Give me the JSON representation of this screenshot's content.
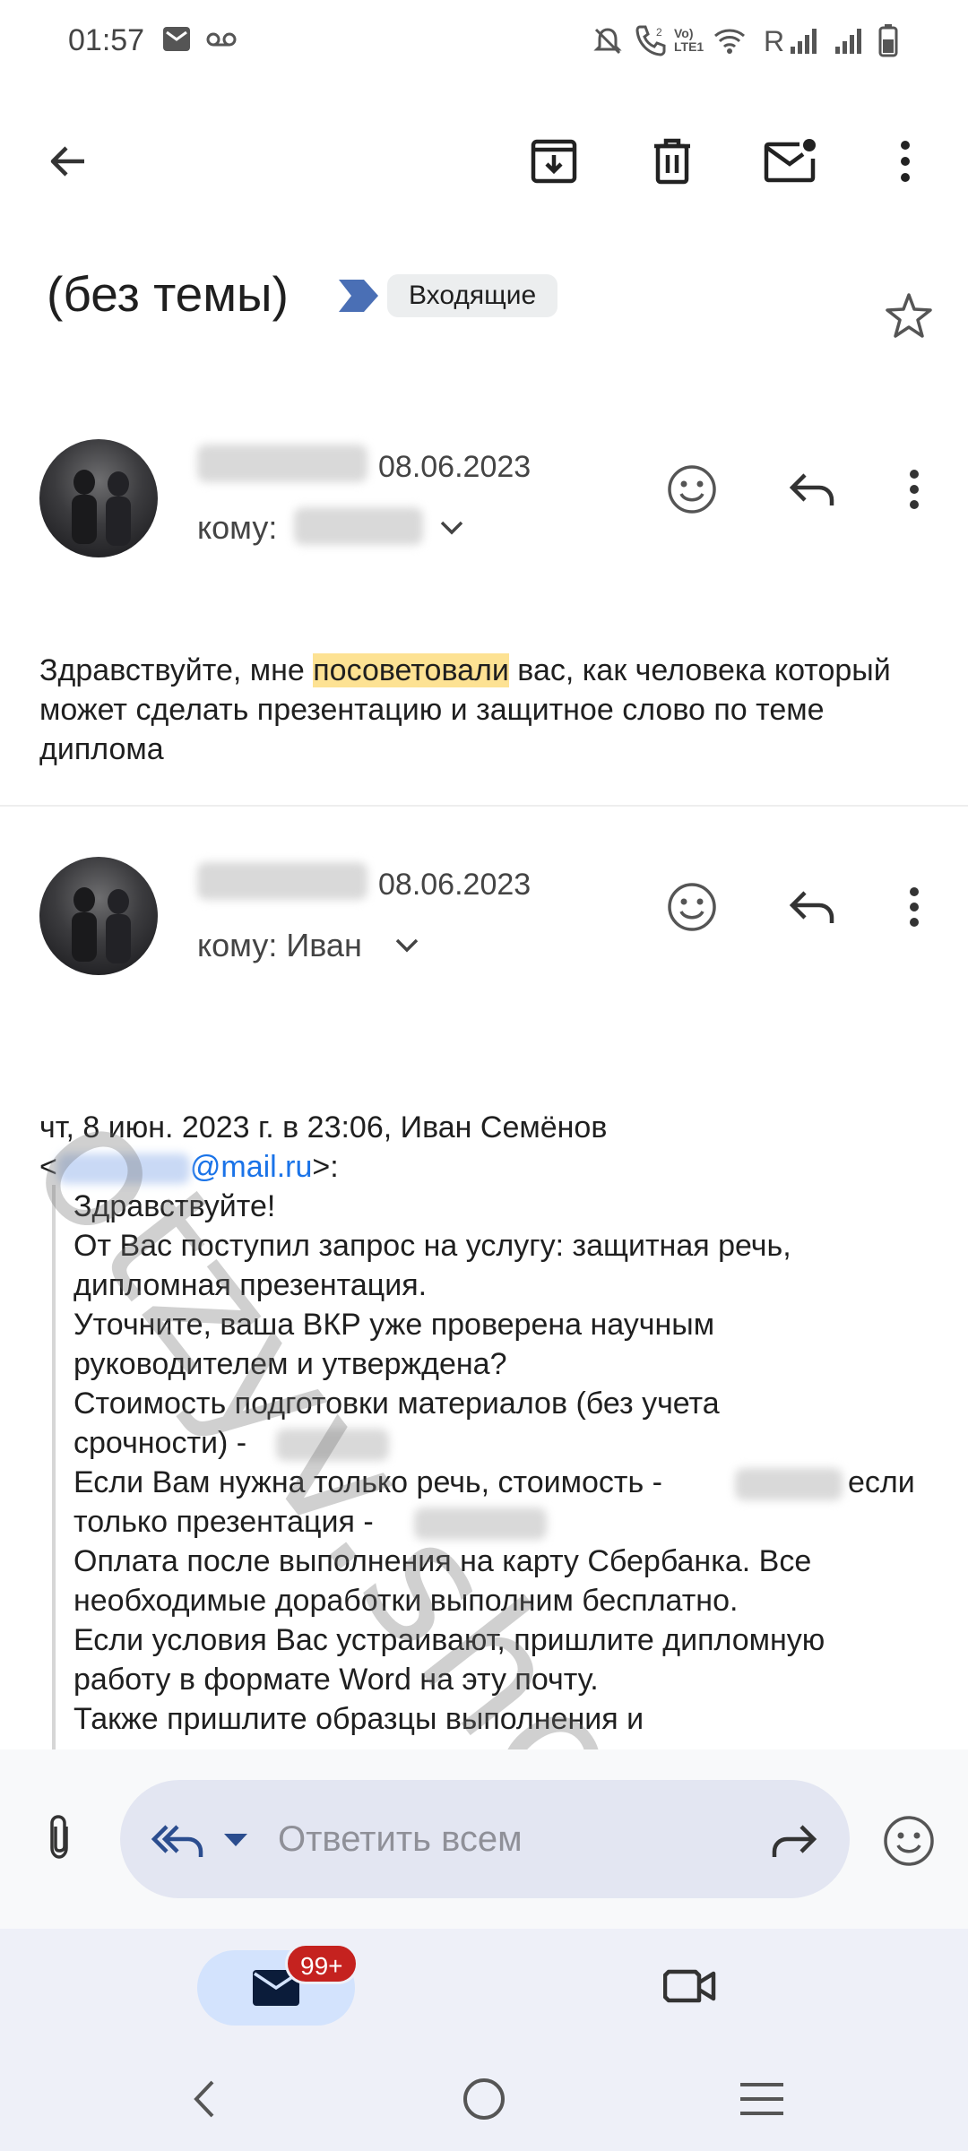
{
  "status_bar": {
    "time": "01:57",
    "roaming": "R",
    "icons": [
      "email-notification-icon",
      "voicemail-icon",
      "mute-icon",
      "wifi-call-icon",
      "volte-icon",
      "wifi-icon",
      "signal-icon",
      "signal-icon",
      "battery-icon"
    ]
  },
  "toolbar": {
    "icons": [
      "back-arrow-icon",
      "archive-icon",
      "delete-icon",
      "mark-unread-icon",
      "more-vert-icon"
    ]
  },
  "subject": {
    "title": "(без темы)",
    "label": "Входящие"
  },
  "messages": [
    {
      "date": "08.06.2023",
      "to_prefix": "кому:",
      "body_before": "Здравствуйте, мне ",
      "body_highlight": "посоветовали",
      "body_after": " вас, как человека который может сделать презентацию и защитное слово по теме диплома"
    },
    {
      "date": "08.06.2023",
      "to_prefix": "кому: Иван",
      "quote_header_line1": "чт, 8 июн. 2023 г. в 23:06, Иван Семёнов",
      "quote_header_lt": "<",
      "quote_email_domain": "@mail.ru",
      "quote_header_gt": ">:",
      "quote_lines": [
        "Здравствуйте!",
        "От Вас поступил запрос на услугу: защитная речь,",
        "дипломная презентация.",
        "Уточните, ваша ВКР уже проверена научным",
        "руководителем и утверждена?",
        "Стоимость подготовки материалов (без учета",
        "срочности) -",
        "Если Вам нужна только речь, стоимость -",
        "если",
        "только презентация -",
        "Оплата после выполнения на карту Сбербанка. Все",
        "необходимые доработки выполним бесплатно.",
        "Если условия Вас устраивают, пришлите дипломную",
        "работу в формате Word на эту почту.",
        "Также пришлите образцы выполнения и"
      ]
    }
  ],
  "watermark": "otzyv.shop",
  "reply_bar": {
    "placeholder": "Ответить всем"
  },
  "bottom_nav": {
    "mail_badge": "99+"
  },
  "colors": {
    "highlight": "#fde293",
    "link": "#1a73e8",
    "badge": "#c5221f",
    "label_arrow": "#4a6fb5"
  }
}
